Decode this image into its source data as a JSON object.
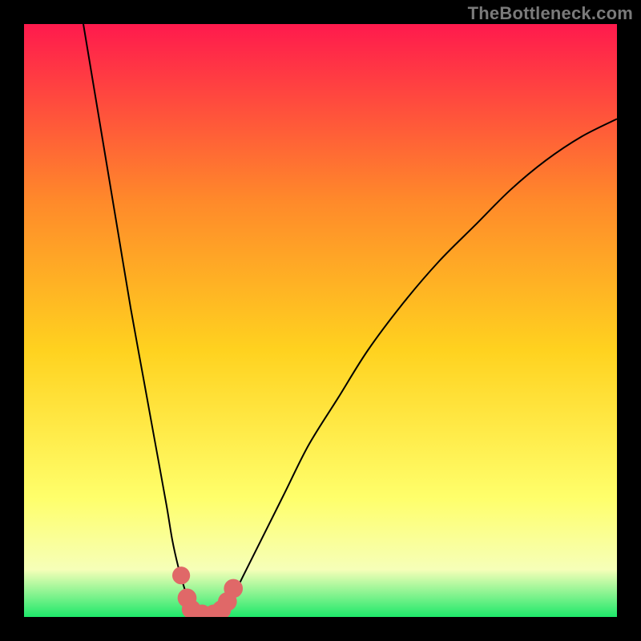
{
  "watermark": "TheBottleneck.com",
  "colors": {
    "frame": "#000000",
    "gradient_top": "#ff1a4d",
    "gradient_mid_upper": "#ff8a2a",
    "gradient_mid": "#ffd21f",
    "gradient_lower": "#ffff6b",
    "gradient_pale": "#f6ffb8",
    "gradient_bottom": "#1ee86a",
    "curve": "#000000",
    "marker": "#e06868"
  },
  "chart_data": {
    "type": "line",
    "title": "",
    "xlabel": "",
    "ylabel": "",
    "xlim": [
      0,
      100
    ],
    "ylim": [
      0,
      100
    ],
    "series": [
      {
        "name": "left-curve",
        "x": [
          10,
          12,
          14,
          16,
          18,
          20,
          22,
          24,
          25,
          26,
          27,
          27.5,
          28,
          28.5
        ],
        "y": [
          100,
          88,
          76,
          64,
          52,
          41,
          30,
          19,
          13,
          8.5,
          5,
          3.5,
          2,
          1
        ]
      },
      {
        "name": "valley-floor",
        "x": [
          28.5,
          30,
          32,
          33.5
        ],
        "y": [
          1,
          0.5,
          0.5,
          1
        ]
      },
      {
        "name": "right-curve",
        "x": [
          33.5,
          35,
          37,
          40,
          44,
          48,
          53,
          58,
          64,
          70,
          76,
          82,
          88,
          94,
          100
        ],
        "y": [
          1,
          3,
          7,
          13,
          21,
          29,
          37,
          45,
          53,
          60,
          66,
          72,
          77,
          81,
          84
        ]
      }
    ],
    "markers": [
      {
        "x": 26.5,
        "y": 7,
        "r": 1.5
      },
      {
        "x": 27.5,
        "y": 3.2,
        "r": 1.6
      },
      {
        "x": 28.2,
        "y": 1.3,
        "r": 1.6
      },
      {
        "x": 30,
        "y": 0.5,
        "r": 1.6
      },
      {
        "x": 32,
        "y": 0.5,
        "r": 1.6
      },
      {
        "x": 33.3,
        "y": 1.2,
        "r": 1.6
      },
      {
        "x": 34.3,
        "y": 2.6,
        "r": 1.6
      },
      {
        "x": 35.3,
        "y": 4.8,
        "r": 1.6
      }
    ]
  }
}
